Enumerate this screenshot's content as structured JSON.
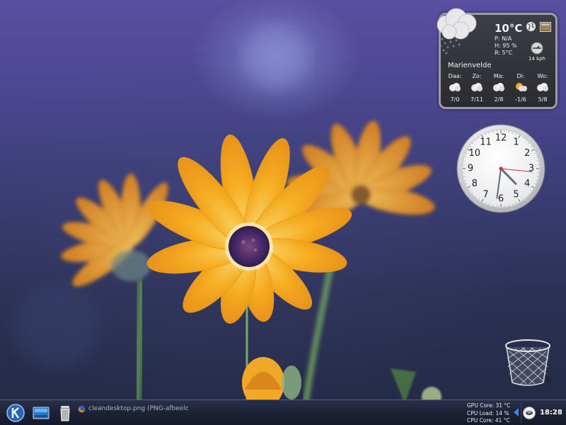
{
  "weather": {
    "temperature": "10°C",
    "pressure": "P: N/A",
    "humidity": "H: 95 %",
    "feels_like": "R: 5°C",
    "wind_speed": "14 kph",
    "location": "Marienvelde",
    "forecast": [
      {
        "day": "Daa:",
        "temps": "7/0",
        "icon": "cloudy-icon"
      },
      {
        "day": "Zo:",
        "temps": "7/11",
        "icon": "cloudy-icon"
      },
      {
        "day": "Ma:",
        "temps": "2/8",
        "icon": "cloudy-icon"
      },
      {
        "day": "Di:",
        "temps": "-1/6",
        "icon": "sun-cloud-icon"
      },
      {
        "day": "Wo:",
        "temps": "5/8",
        "icon": "cloudy-icon"
      }
    ]
  },
  "clock": {
    "numerals": [
      "12",
      "1",
      "2",
      "3",
      "4",
      "5",
      "6",
      "7",
      "8",
      "9",
      "10",
      "11"
    ],
    "hours": 4,
    "minutes": 31,
    "seconds": 16
  },
  "taskbar": {
    "launchers": [
      "kde-menu-icon",
      "show-desktop-icon",
      "trash-launcher-icon"
    ],
    "task_title": "cleandesktop.png (PNG-afbeelding..."
  },
  "sensors": {
    "gpu": "GPU Core: 31 °C",
    "cpu_load": "CPU Load: 14 %",
    "cpu_core": "CPU Core: 41 °C"
  },
  "system_clock": "18:28",
  "colors": {
    "petal": "#f6a81c",
    "flower_center": "#4b2a6a",
    "panel": "#1d2236"
  }
}
